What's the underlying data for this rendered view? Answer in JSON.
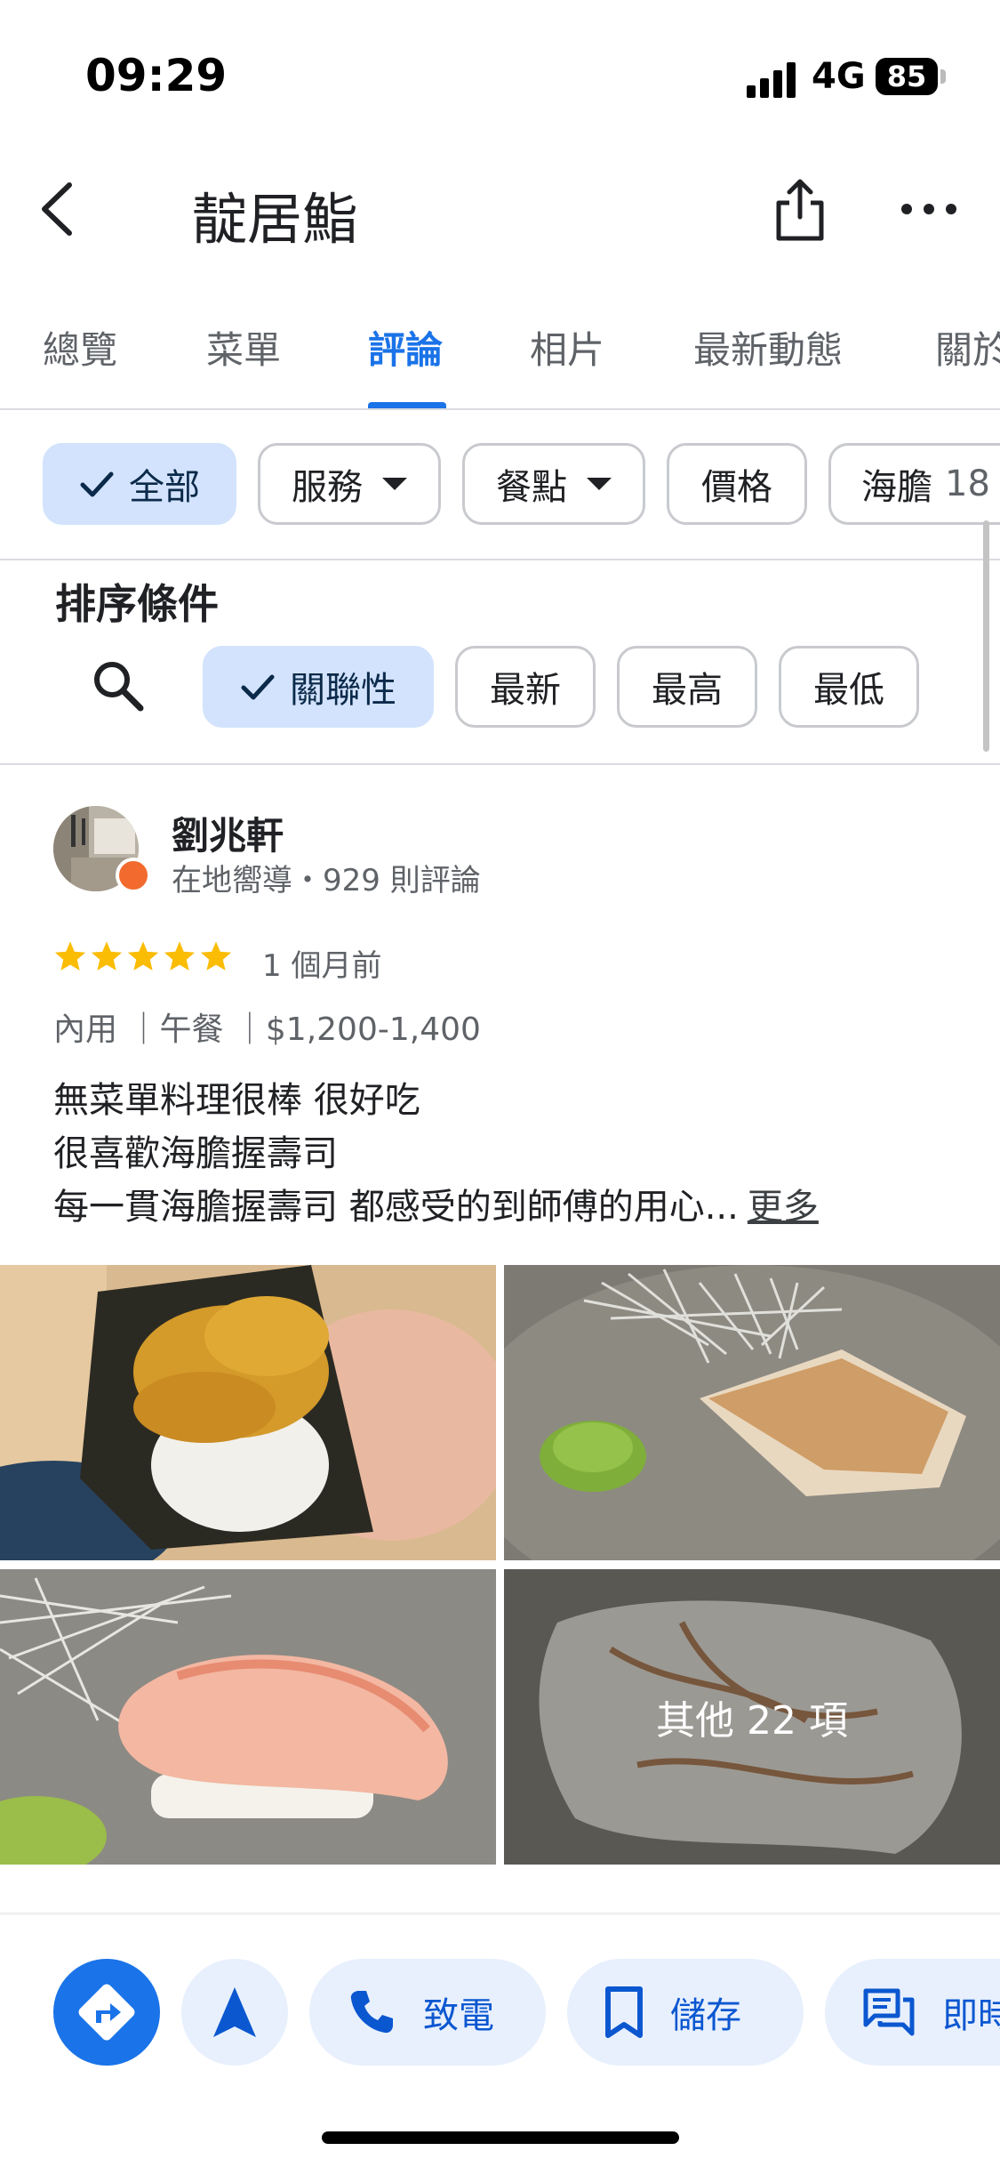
{
  "status_bar": {
    "time": "09:29",
    "network": "4G",
    "battery": "85"
  },
  "header": {
    "title": "靛居鮨"
  },
  "tabs": [
    "總覽",
    "菜單",
    "評論",
    "相片",
    "最新動態",
    "關於"
  ],
  "active_tab": "評論",
  "filters": [
    {
      "label": "全部",
      "selected": true,
      "dropdown": false
    },
    {
      "label": "服務",
      "selected": false,
      "dropdown": true
    },
    {
      "label": "餐點",
      "selected": false,
      "dropdown": true
    },
    {
      "label": "價格",
      "selected": false,
      "dropdown": false
    },
    {
      "label": "海膽",
      "count": "18",
      "selected": false,
      "dropdown": false
    }
  ],
  "sort": {
    "label": "排序條件",
    "options": [
      {
        "label": "關聯性",
        "selected": true
      },
      {
        "label": "最新",
        "selected": false
      },
      {
        "label": "最高",
        "selected": false
      },
      {
        "label": "最低",
        "selected": false
      }
    ]
  },
  "review": {
    "author": "劉兆軒",
    "meta": "在地嚮導・929 則評論",
    "rating": 5,
    "date": "1 個月前",
    "tags": "內用 ｜午餐 ｜$1,200-1,400",
    "lines": [
      "無菜單料理很棒 很好吃",
      "很喜歡海膽握壽司",
      "每一貫海膽握壽司 都感受的到師傅的用心..."
    ],
    "more": "更多",
    "photo_overlay": "其他 22 項"
  },
  "actions": [
    {
      "label": "",
      "icon": "directions-icon"
    },
    {
      "label": "",
      "icon": "navigation-arrow-icon"
    },
    {
      "label": "致電",
      "icon": "phone-icon"
    },
    {
      "label": "儲存",
      "icon": "bookmark-icon"
    },
    {
      "label": "即時",
      "icon": "chat-icon"
    }
  ],
  "colors": {
    "accent": "#1a73e8",
    "chip_selected": "#d3e3fd",
    "star": "#fbbc04",
    "action_pill": "#e8f0fe"
  }
}
